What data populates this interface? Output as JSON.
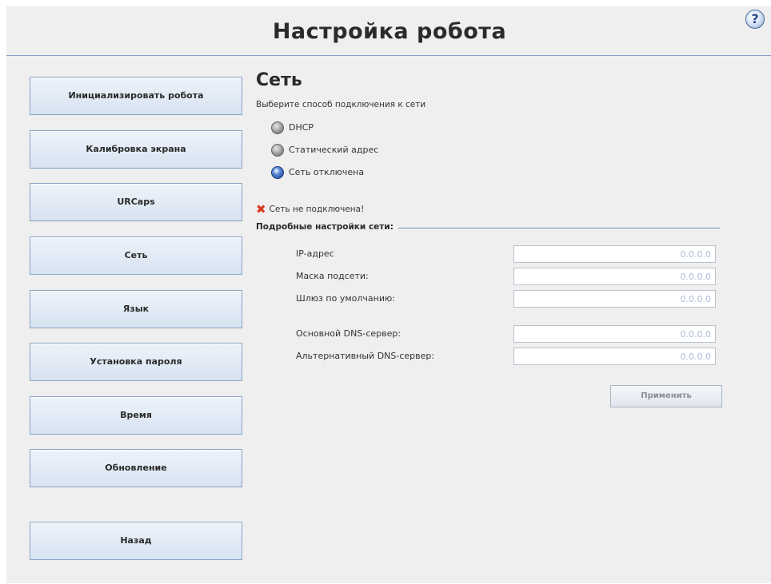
{
  "header": {
    "title": "Настройка робота",
    "help_glyph": "?"
  },
  "sidebar": {
    "items": [
      {
        "label": "Инициализировать робота"
      },
      {
        "label": "Калибровка экрана"
      },
      {
        "label": "URCaps"
      },
      {
        "label": "Сеть"
      },
      {
        "label": "Язык"
      },
      {
        "label": "Установка пароля"
      },
      {
        "label": "Время"
      },
      {
        "label": "Обновление"
      },
      {
        "label": "Назад"
      }
    ]
  },
  "network": {
    "title": "Сеть",
    "subtitle": "Выберите способ подключения к сети",
    "options": [
      {
        "label": "DHCP",
        "selected": false
      },
      {
        "label": "Статический адрес",
        "selected": false
      },
      {
        "label": "Сеть отключена",
        "selected": true
      }
    ],
    "status_text": "Сеть не подключена!",
    "status_color": "#d83a1e",
    "details_label": "Подробные настройки сети:",
    "fields": [
      {
        "label": "IP-адрес",
        "value": "0.0.0.0"
      },
      {
        "label": "Маска подсети:",
        "value": "0.0.0.0"
      },
      {
        "label": "Шлюз по умолчанию:",
        "value": "0.0.0.0"
      },
      {
        "label": "Основной DNS-сервер:",
        "value": "0.0.0.0"
      },
      {
        "label": "Альтернативный DNS-сервер:",
        "value": "0.0.0.0"
      }
    ],
    "apply_label": "Применить"
  },
  "colors": {
    "accent": "#8aa4c8",
    "panel_bg": "#efefef"
  }
}
